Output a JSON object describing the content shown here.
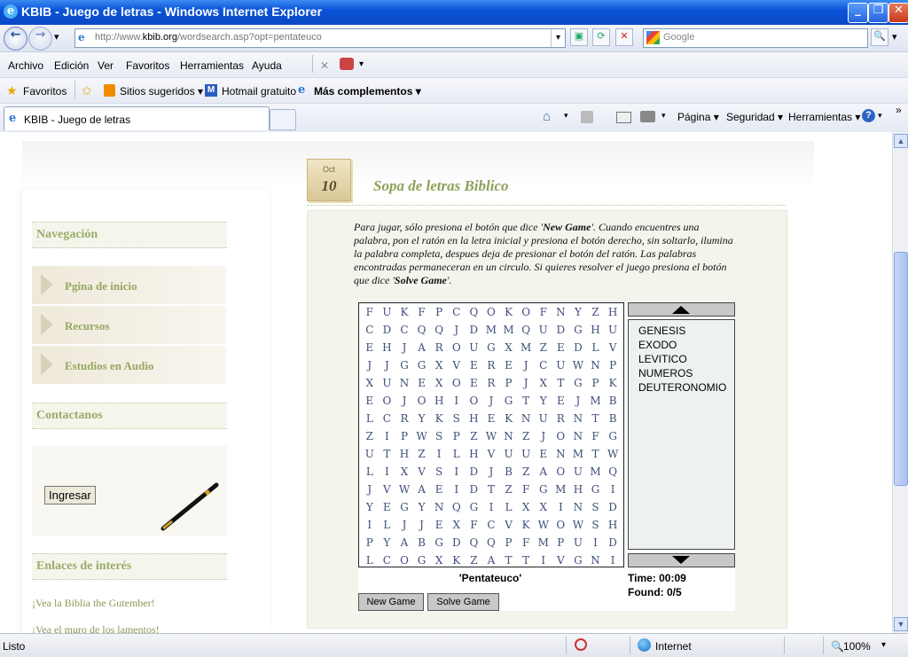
{
  "window": {
    "title": "KBIB - Juego de letras - Windows Internet Explorer",
    "ie_glyph": "e",
    "min": "_",
    "max": "❐",
    "close": "✕"
  },
  "address": {
    "prefix": "http://www.",
    "domain": "kbib.org",
    "path": "/wordsearch.asp?opt=pentateuco",
    "back": "←",
    "forward": "→",
    "drop": "▾",
    "refresh": "⟳",
    "stop": "✕",
    "compat": "▣"
  },
  "search": {
    "placeholder": "Google",
    "go": "🔍",
    "drop": "▾"
  },
  "menu": [
    "Archivo",
    "Edición",
    "Ver",
    "Favoritos",
    "Herramientas",
    "Ayuda"
  ],
  "favorites": {
    "label": "Favoritos",
    "items": [
      "Sitios sugeridos ▾",
      "Hotmail gratuito",
      "Más complementos ▾"
    ]
  },
  "tab": {
    "title": "KBIB - Juego de letras"
  },
  "commands": {
    "pagina": "Página ▾",
    "seguridad": "Seguridad ▾",
    "herramientas": "Herramientas ▾",
    "help": "?",
    "more": "»"
  },
  "page": {
    "date_month": "Oct",
    "date_day": "10",
    "heading": "Sopa de letras Biblico",
    "intro_pre": "Para jugar, sólo presiona el botón que dice '",
    "intro_new": "New Game",
    "intro_mid": "'. Cuando encuentres una palabra, pon el ratón en la letra inicial y presiona el botón derecho, sin soltarlo, ilumina la palabra completa, despues deja de presionar el botón del ratón. Las palabras encontradas permaneceran en un circulo. Si quieres resolver el juego presiona el botón que dice '",
    "intro_solve": "Solve Game",
    "intro_end": "'.",
    "sidebar": {
      "nav_header": "Navegación",
      "nav_items": [
        "Pgina de inicio",
        "Recursos",
        "Estudios en Audio"
      ],
      "contact_header": "Contactanos",
      "login_button": "Ingresar",
      "links_header": "Enlaces de interés",
      "links": [
        "¡Vea la Biblia the Gutember!",
        "¡Vea el muro de los lamentos!"
      ]
    },
    "game": {
      "grid": [
        "FUKFPCQOKOFNYZH",
        "CDCQQJDMMQUDGHU",
        "EHJAROUGXMZEDLV",
        "JJGGXVEREJCUWNP",
        "XUNEXOERPJXTGPK",
        "EOJOHIOJGTYEJMB",
        "LCRYKSHEKNURNTB",
        "ZIPWSPZWNZJONFG",
        "UTHZILHVUUENMTW",
        "LIXVSIDJBZAOUMQ",
        "JVWAEIDTZFGMHGI",
        "YEGYNQGILXXINSD",
        "ILJJEXFCVKWOWSH",
        "PYABGDQQPFMPUID",
        "LCOGXKZATTIVGNI"
      ],
      "words": [
        "GENESIS",
        "EXODO",
        "LEVITICO",
        "NUMEROS",
        "DEUTERONOMIO"
      ],
      "category": "'Pentateuco'",
      "time": "Time: 00:09",
      "found": "Found: 0/5",
      "new_game": "New Game",
      "solve_game": "Solve Game"
    }
  },
  "status": {
    "text": "Listo",
    "zone": "Internet",
    "zoom": "100%",
    "zoom_drop": "▾"
  }
}
